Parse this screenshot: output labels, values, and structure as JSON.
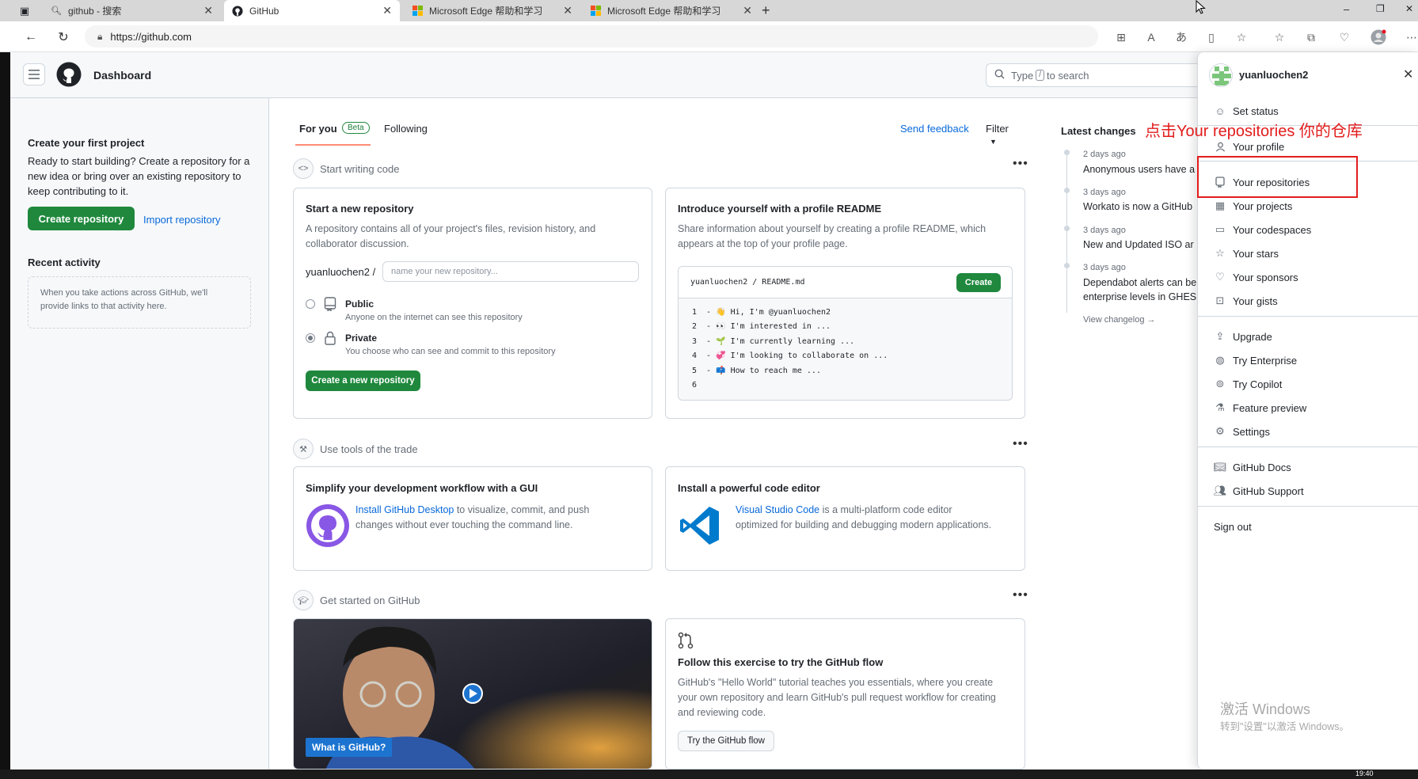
{
  "browser": {
    "tabs": [
      {
        "label": "github - 搜索",
        "icon": "search-icon"
      },
      {
        "label": "GitHub",
        "icon": "github-icon",
        "active": true
      },
      {
        "label": "Microsoft Edge 帮助和学习",
        "icon": "microsoft-icon"
      },
      {
        "label": "Microsoft Edge 帮助和学习",
        "icon": "microsoft-icon"
      }
    ],
    "url": "https://github.com",
    "window_controls": {
      "minimize": "–",
      "restore": "❐",
      "close": "✕"
    }
  },
  "header": {
    "title": "Dashboard",
    "search": {
      "before": "Type",
      "key": "/",
      "after": "to search"
    }
  },
  "sidebar": {
    "create_title": "Create your first project",
    "create_desc": "Ready to start building? Create a repository for a new idea or bring over an existing repository to keep contributing to it.",
    "create_button": "Create repository",
    "import_link": "Import repository",
    "recent_title": "Recent activity",
    "recent_empty": "When you take actions across GitHub, we'll provide links to that activity here."
  },
  "feed": {
    "tab_for_you": "For you",
    "beta": "Beta",
    "tab_following": "Following",
    "send_feedback": "Send feedback",
    "filter": "Filter",
    "sections": [
      {
        "title": "Start writing code",
        "icon": "code-icon"
      },
      {
        "title": "Use tools of the trade",
        "icon": "tools-icon"
      },
      {
        "title": "Get started on GitHub",
        "icon": "mortarboard-icon"
      }
    ],
    "new_repo_card": {
      "title": "Start a new repository",
      "desc": "A repository contains all of your project's files, revision history, and collaborator discussion.",
      "owner": "yuanluochen2 /",
      "placeholder": "name your new repository...",
      "public_label": "Public",
      "public_desc": "Anyone on the internet can see this repository",
      "private_label": "Private",
      "private_desc": "You choose who can see and commit to this repository",
      "button": "Create a new repository"
    },
    "readme_card": {
      "title": "Introduce yourself with a profile README",
      "desc": "Share information about yourself by creating a profile README, which appears at the top of your profile page.",
      "path": "yuanluochen2 / README.md",
      "button": "Create",
      "lines": [
        "1  - 👋 Hi, I'm @yuanluochen2",
        "2  - 👀 I'm interested in ...",
        "3  - 🌱 I'm currently learning ...",
        "4  - 💞 I'm looking to collaborate on ...",
        "5  - 📫 How to reach me ...",
        "6"
      ]
    },
    "desktop_card": {
      "title": "Simplify your development workflow with a GUI",
      "link": "Install GitHub Desktop",
      "text1": " to visualize, commit, and push",
      "text2": "changes without ever touching the command line."
    },
    "editor_card": {
      "title": "Install a powerful code editor",
      "link": "Visual Studio Code",
      "text1": " is a multi-platform code editor",
      "text2": "optimized for building and debugging modern applications."
    },
    "video_card": {
      "caption": "What is GitHub?"
    },
    "flow_card": {
      "title": "Follow this exercise to try the GitHub flow",
      "desc": "GitHub's \"Hello World\" tutorial teaches you essentials, where you create your own repository and learn GitHub's pull request workflow for creating and reviewing code.",
      "button": "Try the GitHub flow"
    }
  },
  "latest": {
    "title": "Latest changes",
    "items": [
      {
        "date": "2 days ago",
        "title": "Anonymous users have a"
      },
      {
        "date": "3 days ago",
        "title": "Workato is now a GitHub"
      },
      {
        "date": "3 days ago",
        "title": "New and Updated ISO ar"
      },
      {
        "date": "3 days ago",
        "title": "Dependabot alerts can be",
        "title2": "enterprise levels in GHES"
      }
    ],
    "view_changelog": "View changelog →"
  },
  "annotation": {
    "text": "点击Your repositories 你的仓库",
    "color": "#e21c1c"
  },
  "user_menu": {
    "username": "yuanluochen2",
    "close": "✕",
    "items": [
      {
        "label": "Set status",
        "icon": "smiley-icon"
      },
      {
        "label": "Your profile",
        "icon": "person-icon"
      },
      {
        "label": "Your repositories",
        "icon": "repo-icon"
      },
      {
        "label": "Your projects",
        "icon": "table-icon"
      },
      {
        "label": "Your codespaces",
        "icon": "codespaces-icon"
      },
      {
        "label": "Your stars",
        "icon": "star-icon"
      },
      {
        "label": "Your sponsors",
        "icon": "heart-icon"
      },
      {
        "label": "Your gists",
        "icon": "code-square-icon"
      },
      {
        "label": "Upgrade",
        "icon": "upload-icon"
      },
      {
        "label": "Try Enterprise",
        "icon": "globe-icon"
      },
      {
        "label": "Try Copilot",
        "icon": "copilot-icon"
      },
      {
        "label": "Feature preview",
        "icon": "beaker-icon"
      },
      {
        "label": "Settings",
        "icon": "gear-icon"
      },
      {
        "label": "GitHub Docs",
        "icon": "book-icon"
      },
      {
        "label": "GitHub Support",
        "icon": "people-icon"
      },
      {
        "label": "Sign out",
        "icon": ""
      }
    ],
    "watermark_title": "激活 Windows",
    "watermark_sub": "转到\"设置\"以激活 Windows。"
  },
  "taskbar": {
    "clock": "19:40"
  },
  "colors": {
    "primary_green": "#1f883d",
    "link_blue": "#0969da",
    "border": "#d0d7de"
  }
}
